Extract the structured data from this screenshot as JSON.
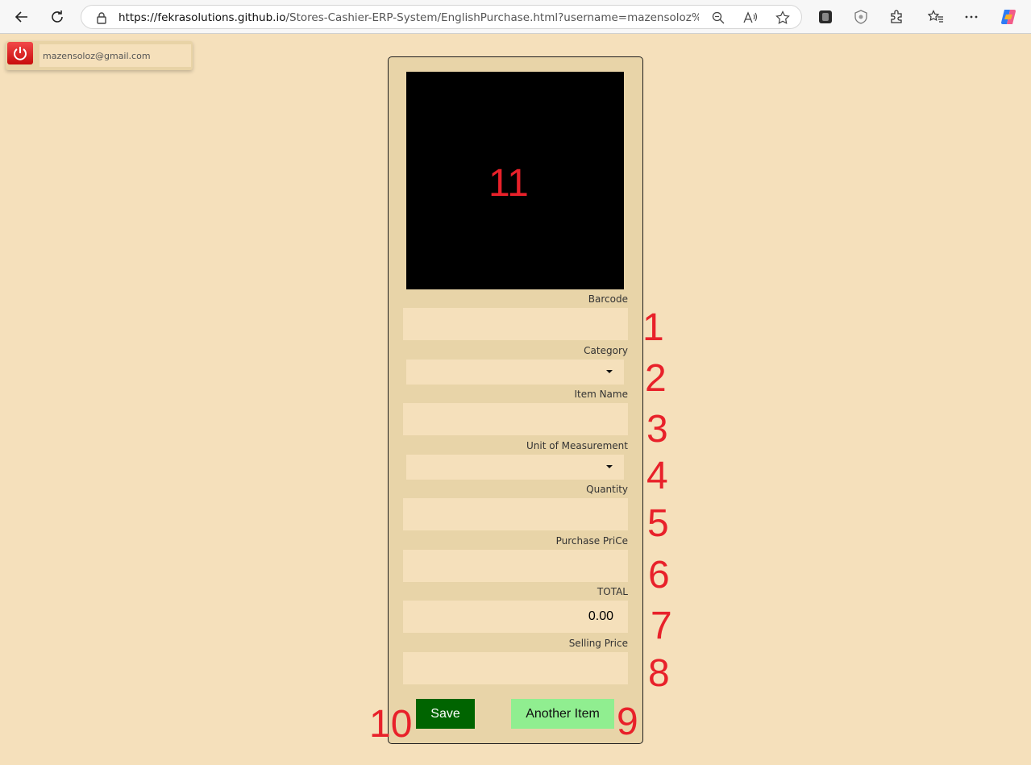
{
  "browser": {
    "url_host": "https://fekrasolutions.github.io",
    "url_path": "/Stores-Cashier-ERP-System/EnglishPurchase.html?username=mazensoloz%40gmai..."
  },
  "user": {
    "email": "mazensoloz@gmail.com"
  },
  "form": {
    "barcode_label": "Barcode",
    "category_label": "Category",
    "category_value": "",
    "item_name_label": "Item Name",
    "unit_label": "Unit of Measurement",
    "unit_value": "",
    "quantity_label": "Quantity",
    "purchase_price_label": "Purchase PriCe",
    "total_label": "TOTAL",
    "total_value": "0.00",
    "selling_price_label": "Selling Price",
    "save_label": "Save",
    "another_item_label": "Another Item"
  },
  "annotations": [
    "1",
    "2",
    "3",
    "4",
    "5",
    "6",
    "7",
    "8",
    "9",
    "10",
    "11"
  ],
  "colors": {
    "page_bg": "#f5e0bb",
    "panel_bg": "#e8d4a8",
    "save_bg": "#006400",
    "another_bg": "#90ee90",
    "annotation": "#e8212a"
  }
}
